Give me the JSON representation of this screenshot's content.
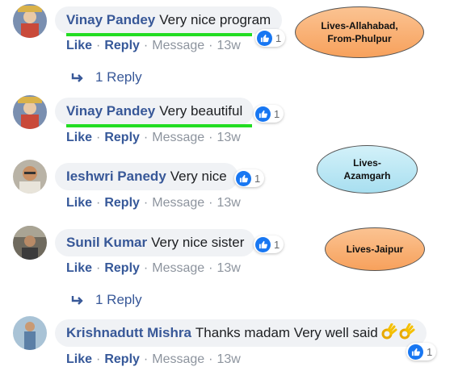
{
  "colors": {
    "accent": "#1877f2",
    "name": "#385898",
    "bubble": "#f0f2f5",
    "muted": "#8d949e",
    "highlight": "#22dd22"
  },
  "comments": [
    {
      "author": "Vinay Pandey",
      "text": "Very nice program",
      "likes": "1",
      "actions": {
        "like": "Like",
        "reply": "Reply",
        "message": "Message",
        "time": "13w"
      },
      "reply_count": "1 Reply"
    },
    {
      "author": "Vinay Pandey",
      "text": "Very beautiful",
      "likes": "1",
      "actions": {
        "like": "Like",
        "reply": "Reply",
        "message": "Message",
        "time": "13w"
      }
    },
    {
      "author": "Ieshwri Panedy",
      "text": "Very nice",
      "likes": "1",
      "actions": {
        "like": "Like",
        "reply": "Reply",
        "message": "Message",
        "time": "13w"
      }
    },
    {
      "author": "Sunil Kumar",
      "text": "Very nice sister",
      "likes": "1",
      "actions": {
        "like": "Like",
        "reply": "Reply",
        "message": "Message",
        "time": "13w"
      },
      "reply_count": "1 Reply"
    },
    {
      "author": "Krishnadutt Mishra",
      "text": "Thanks madam Very well said",
      "likes": "1",
      "actions": {
        "like": "Like",
        "reply": "Reply",
        "message": "Message",
        "time": "13w"
      }
    }
  ],
  "annotations": [
    {
      "line1": "Lives-Allahabad,",
      "line2": "From-Phulpur"
    },
    {
      "line1": "Lives-",
      "line2": "Azamgarh"
    },
    {
      "line1": "Lives-Jaipur"
    }
  ]
}
